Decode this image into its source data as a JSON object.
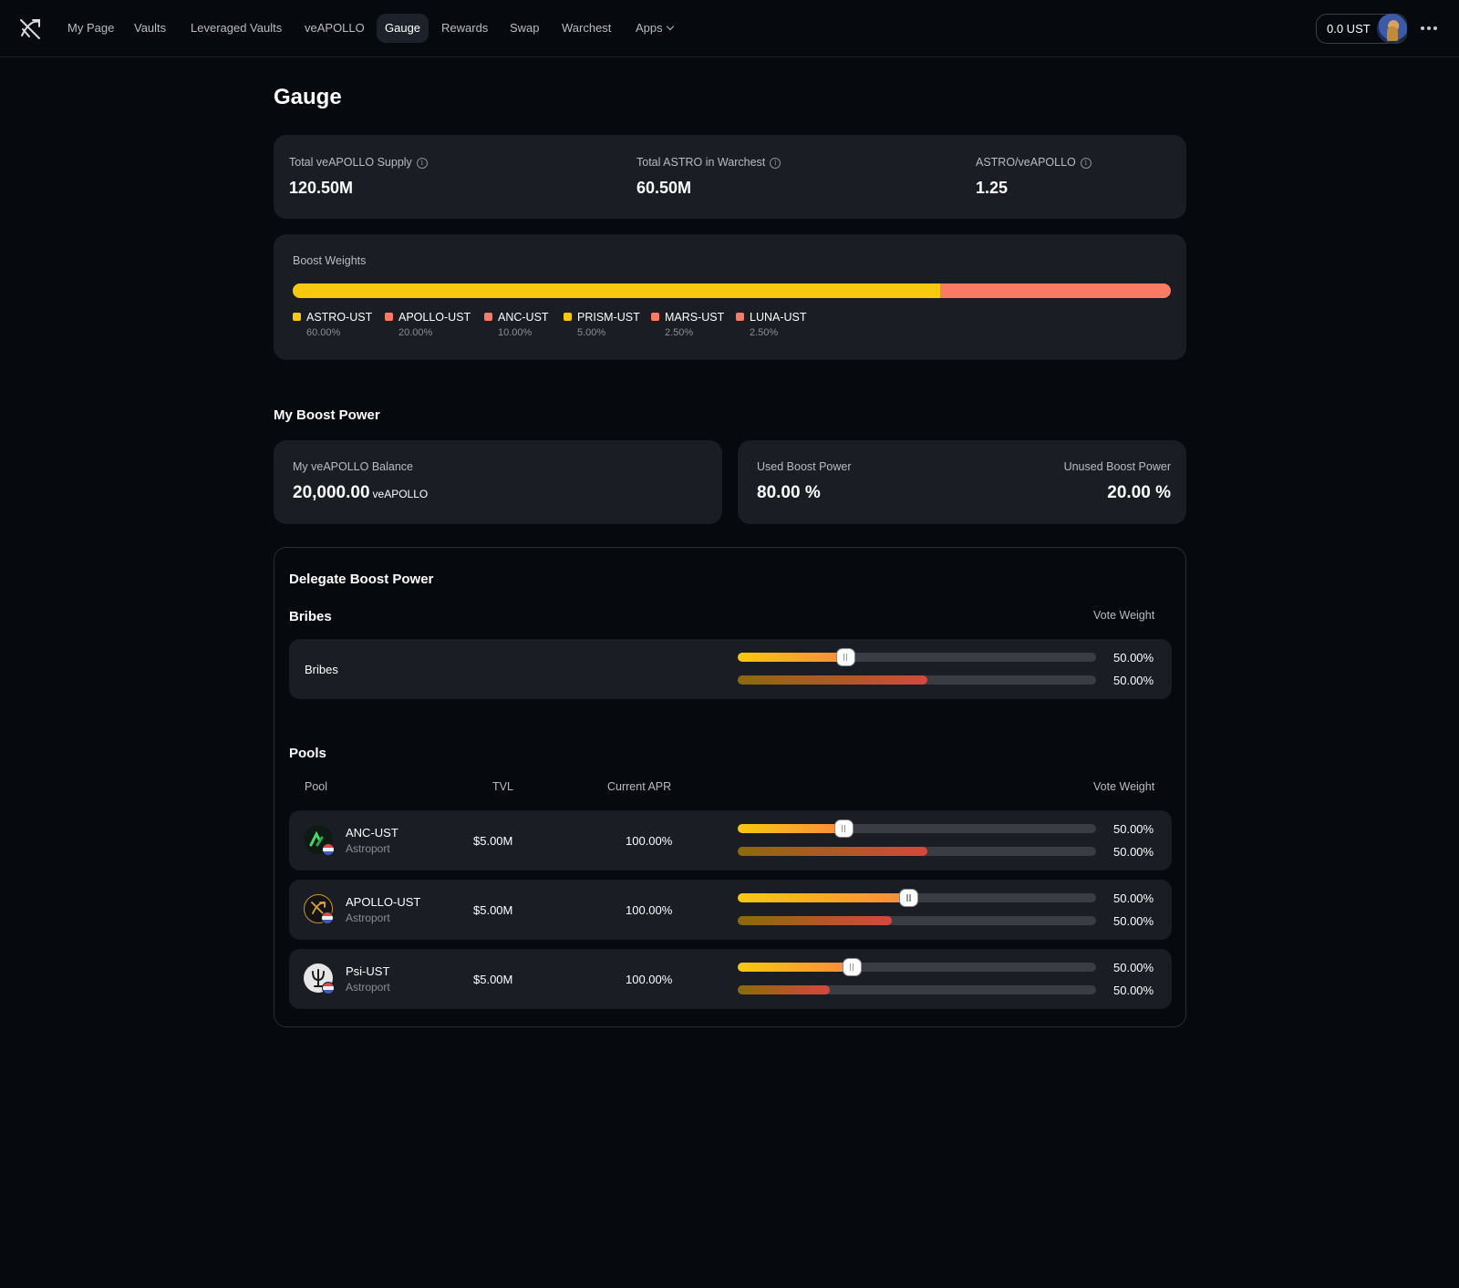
{
  "nav": {
    "items": [
      "My Page",
      "Vaults",
      "Leveraged Vaults",
      "veAPOLLO",
      "Gauge",
      "Rewards",
      "Swap",
      "Warchest",
      "Apps"
    ],
    "active": "Gauge",
    "wallet_balance": "0.0 UST"
  },
  "page": {
    "title": "Gauge"
  },
  "stats": [
    {
      "label": "Total veAPOLLO Supply",
      "value": "120.50M"
    },
    {
      "label": "Total ASTRO in Warchest",
      "value": "60.50M"
    },
    {
      "label": "ASTRO/veAPOLLO",
      "value": "1.25"
    }
  ],
  "boost_weights": {
    "title": "Boost Weights",
    "legend": [
      {
        "name": "ASTRO-UST",
        "pct": "60.00%",
        "color": "#f6c90e"
      },
      {
        "name": "APOLLO-UST",
        "pct": "20.00%",
        "color": "#fb7a64"
      },
      {
        "name": "ANC-UST",
        "pct": "10.00%",
        "color": "#fb7a64"
      },
      {
        "name": "PRISM-UST",
        "pct": "5.00%",
        "color": "#f6c90e"
      },
      {
        "name": "MARS-UST",
        "pct": "2.50%",
        "color": "#fb7a64"
      },
      {
        "name": "LUNA-UST",
        "pct": "2.50%",
        "color": "#fb7a64"
      }
    ],
    "bar_primary_fraction": 0.737
  },
  "my_boost": {
    "title": "My Boost Power",
    "balance_label": "My veAPOLLO Balance",
    "balance_value": "20,000.00",
    "balance_unit": "veAPOLLO",
    "used_label": "Used Boost Power",
    "used_value": "80.00 %",
    "unused_label": "Unused Boost Power",
    "unused_value": "20.00 %"
  },
  "delegate": {
    "title": "Delegate Boost Power",
    "bribes_title": "Bribes",
    "vote_weight_label": "Vote Weight",
    "bribes_row": {
      "name": "Bribes",
      "top_pct": "50.00%",
      "bottom_pct": "50.00%",
      "top_fill": 0.3,
      "bottom_fill": 0.53
    },
    "pools_title": "Pools",
    "pool_headers": {
      "pool": "Pool",
      "tvl": "TVL",
      "apr": "Current APR",
      "vote_weight": "Vote Weight"
    },
    "pools": [
      {
        "name": "ANC-UST",
        "dex": "Astroport",
        "tvl": "$5.00M",
        "apr": "100.00%",
        "top_pct": "50.00%",
        "bottom_pct": "50.00%",
        "top_fill": 0.295,
        "bottom_fill": 0.53,
        "icon": "anchor-icon"
      },
      {
        "name": "APOLLO-UST",
        "dex": "Astroport",
        "tvl": "$5.00M",
        "apr": "100.00%",
        "top_pct": "50.00%",
        "bottom_pct": "50.00%",
        "top_fill": 0.477,
        "bottom_fill": 0.43,
        "icon": "apollo-icon"
      },
      {
        "name": "Psi-UST",
        "dex": "Astroport",
        "tvl": "$5.00M",
        "apr": "100.00%",
        "top_pct": "50.00%",
        "bottom_pct": "50.00%",
        "top_fill": 0.317,
        "bottom_fill": 0.257,
        "icon": "psi-icon"
      }
    ]
  }
}
